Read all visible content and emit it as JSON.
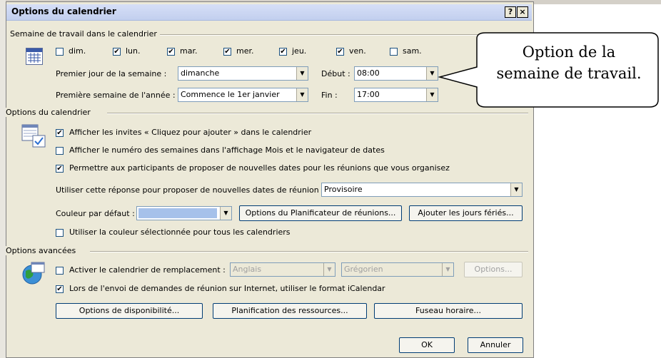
{
  "dialog": {
    "title": "Options du calendrier",
    "help_btn": "?",
    "close_btn": "×"
  },
  "workweek": {
    "section_label": "Semaine de travail dans le calendrier",
    "days": [
      {
        "label": "dim.",
        "checked": false
      },
      {
        "label": "lun.",
        "checked": true
      },
      {
        "label": "mar.",
        "checked": true
      },
      {
        "label": "mer.",
        "checked": true
      },
      {
        "label": "jeu.",
        "checked": true
      },
      {
        "label": "ven.",
        "checked": true
      },
      {
        "label": "sam.",
        "checked": false
      }
    ],
    "first_day_label": "Premier jour de la semaine :",
    "first_day_value": "dimanche",
    "start_label": "Début :",
    "start_value": "08:00",
    "first_week_label": "Première semaine de l'année :",
    "first_week_value": "Commence le 1er janvier",
    "end_label": "Fin :",
    "end_value": "17:00"
  },
  "callout": {
    "line1": "Option de la",
    "line2": "semaine de travail."
  },
  "calendar_options": {
    "section_label": "Options du calendrier",
    "show_invites": {
      "label": "Afficher les invites « Cliquez pour ajouter » dans le calendrier",
      "checked": true
    },
    "show_week_numbers": {
      "label": "Afficher le numéro des semaines dans l'affichage Mois et le navigateur de dates",
      "checked": false
    },
    "allow_propose": {
      "label": "Permettre aux participants de proposer de nouvelles dates pour les réunions que vous organisez",
      "checked": true
    },
    "response_label": "Utiliser cette réponse pour proposer de nouvelles dates de réunion :",
    "response_value": "Provisoire",
    "color_label": "Couleur par défaut :",
    "color_value": "#a6c1ea",
    "planner_btn": "Options du Planificateur de réunions...",
    "holidays_btn": "Ajouter les jours fériés...",
    "use_color_all": {
      "label": "Utiliser la couleur sélectionnée pour tous les calendriers",
      "checked": false
    }
  },
  "advanced": {
    "section_label": "Options avancées",
    "alt_calendar": {
      "label": "Activer le calendrier de remplacement :",
      "checked": false
    },
    "alt_lang": "Anglais",
    "alt_type": "Grégorien",
    "options_btn": "Options...",
    "icalendar": {
      "label": "Lors de l'envoi de demandes de réunion sur Internet, utiliser le format iCalendar",
      "checked": true
    },
    "availability_btn": "Options de disponibilité...",
    "resources_btn": "Planification des ressources...",
    "timezone_btn": "Fuseau horaire..."
  },
  "footer": {
    "ok": "OK",
    "cancel": "Annuler"
  }
}
